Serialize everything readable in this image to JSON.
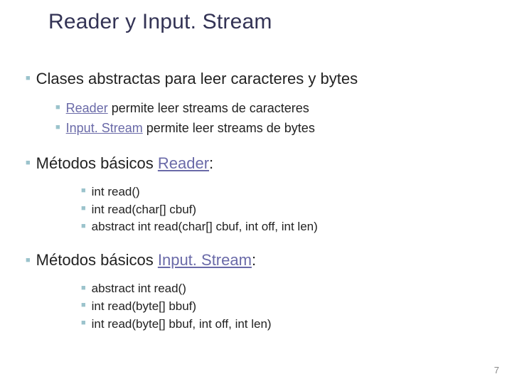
{
  "title": "Reader y Input. Stream",
  "section1": {
    "heading": "Clases abstractas para leer caracteres y bytes",
    "items": [
      {
        "link": "Reader",
        "rest": " permite leer streams de caracteres"
      },
      {
        "link": "Input. Stream",
        "rest": " permite leer streams de bytes"
      }
    ]
  },
  "section2": {
    "heading_pre": "Métodos básicos ",
    "heading_link": "Reader",
    "heading_post": ":",
    "items": [
      "int read()",
      "int read(char[] cbuf)",
      "abstract int read(char[] cbuf, int off, int len)"
    ]
  },
  "section3": {
    "heading_pre": "Métodos básicos ",
    "heading_link": "Input. Stream",
    "heading_post": ":",
    "items": [
      "abstract int read()",
      "int read(byte[] bbuf)",
      "int read(byte[] bbuf, int off, int len)"
    ]
  },
  "page_number": "7"
}
